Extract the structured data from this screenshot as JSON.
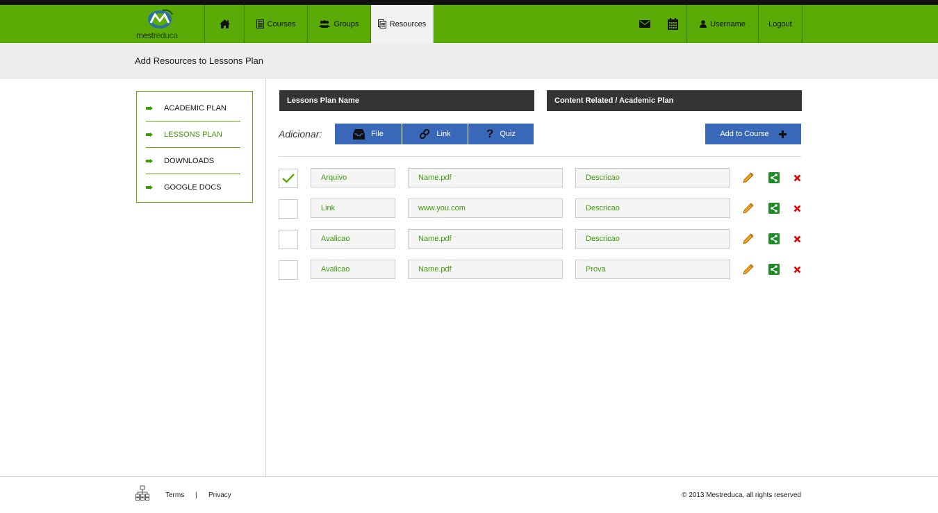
{
  "brand": {
    "logo_text_a": "mest",
    "logo_text_b": "reduca",
    "accent": "#5aab05",
    "blue": "#3a68b8"
  },
  "nav": {
    "home_icon": "home-icon",
    "courses_label": "Courses",
    "groups_label": "Groups",
    "resources_label": "Resources",
    "messages_icon": "mail-icon",
    "calendar_icon": "calendar-icon",
    "username_label": "Username",
    "logout_label": "Logout"
  },
  "page_title": "Add Resources to Lessons Plan",
  "sidebar": {
    "items": [
      {
        "label": "ACADEMIC PLAN",
        "active": false
      },
      {
        "label": "LESSONS PLAN",
        "active": true
      },
      {
        "label": "DOWNLOADS",
        "active": false
      },
      {
        "label": "GOOGLE DOCS",
        "active": false
      }
    ]
  },
  "main": {
    "lessons_plan_header": "Lessons Plan Name",
    "content_related_header": "Content Related / Academic Plan",
    "adicionar_label": "Adicionar:",
    "add_buttons": {
      "file": "File",
      "link": "Link",
      "quiz": "Quiz"
    },
    "add_to_course_label": "Add to Course",
    "rows": [
      {
        "checked": true,
        "type": "Arquivo",
        "name": "Name.pdf",
        "description": "Descricao"
      },
      {
        "checked": false,
        "type": "Link",
        "name": "www.you.com",
        "description": "Descricao"
      },
      {
        "checked": false,
        "type": "Avalicao",
        "name": "Name.pdf",
        "description": "Descricao"
      },
      {
        "checked": false,
        "type": "Avalicao",
        "name": "Name.pdf",
        "description": "Prova"
      }
    ]
  },
  "footer": {
    "terms": "Terms",
    "separator": "|",
    "privacy": "Privacy",
    "copyright": "© 2013 Mestreduca, all rights reserved"
  }
}
